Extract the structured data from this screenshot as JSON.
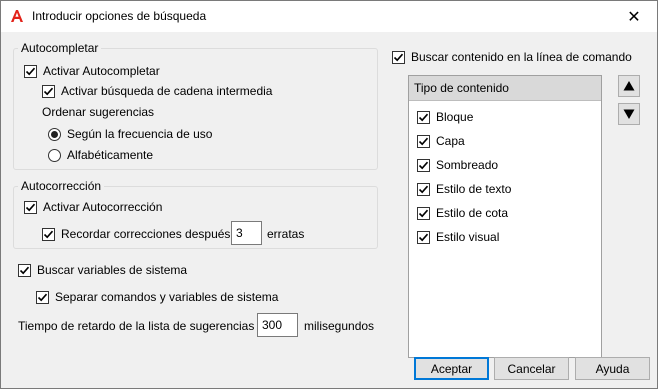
{
  "window": {
    "title": "Introducir opciones de búsqueda",
    "close_glyph": "✕",
    "app_icon": "autocad-a-icon",
    "accent_color": "#e2231a"
  },
  "autocomplete": {
    "legend": "Autocompletar",
    "enable_label": "Activar Autocompletar",
    "enable_checked": true,
    "mid_string_label": "Activar búsqueda de cadena intermedia",
    "mid_string_checked": true,
    "sort_label": "Ordenar sugerencias",
    "sort_options": [
      {
        "label": "Según la frecuencia de uso",
        "selected": true
      },
      {
        "label": "Alfabéticamente",
        "selected": false
      }
    ]
  },
  "autocorrect": {
    "legend": "Autocorrección",
    "enable_label": "Activar Autocorrección",
    "enable_checked": true,
    "remember_label": "Recordar correcciones después",
    "remember_checked": true,
    "remember_value": "3",
    "remember_suffix": "erratas"
  },
  "system_vars": {
    "search_label": "Buscar variables de sistema",
    "search_checked": true,
    "separate_label": "Separar comandos y variables de sistema",
    "separate_checked": true
  },
  "delay": {
    "label": "Tiempo de retardo de la lista de sugerencias",
    "value": "300",
    "unit": "milisegundos"
  },
  "content_search": {
    "label": "Buscar contenido en la línea de comando",
    "checked": true,
    "list_header": "Tipo de contenido",
    "items": [
      {
        "label": "Bloque",
        "checked": true
      },
      {
        "label": "Capa",
        "checked": true
      },
      {
        "label": "Sombreado",
        "checked": true
      },
      {
        "label": "Estilo de texto",
        "checked": true
      },
      {
        "label": "Estilo de cota",
        "checked": true
      },
      {
        "label": "Estilo visual",
        "checked": true
      }
    ],
    "move_up_icon": "triangle-up-icon",
    "move_down_icon": "triangle-down-icon"
  },
  "buttons": {
    "accept": "Aceptar",
    "cancel": "Cancelar",
    "help": "Ayuda"
  }
}
